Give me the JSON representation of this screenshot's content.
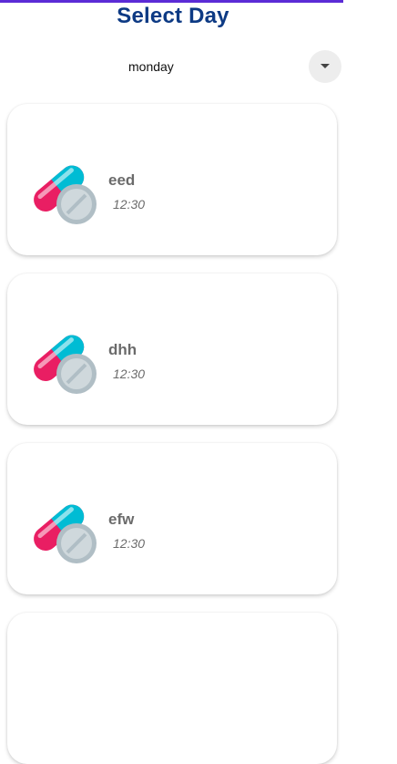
{
  "header": {
    "title": "Select Day"
  },
  "day_selector": {
    "selected": "monday",
    "icon": "caret-down-icon"
  },
  "medications": [
    {
      "name": "eed",
      "time": "12:30",
      "icon": "pill-capsule-icon"
    },
    {
      "name": "dhh",
      "time": "12:30",
      "icon": "pill-capsule-icon"
    },
    {
      "name": "efw",
      "time": "12:30",
      "icon": "pill-capsule-icon"
    }
  ],
  "colors": {
    "title": "#0d3a84",
    "accent_line": "#5b2bd6",
    "capsule_pink": "#e91e63",
    "capsule_cyan": "#00bcd4",
    "tablet_gray": "#b0bec5"
  }
}
